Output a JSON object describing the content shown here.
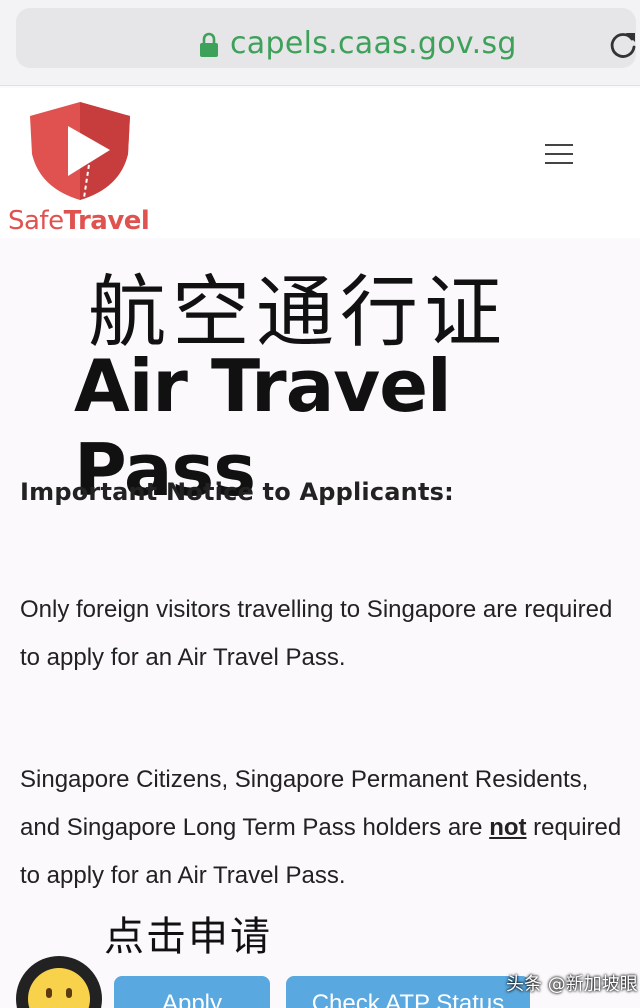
{
  "browser": {
    "url": "capels.caas.gov.sg",
    "lock_icon": "lock-icon",
    "reload_icon": "reload-icon",
    "url_color": "#3da15a"
  },
  "header": {
    "logo_safe": "Safe",
    "logo_travel": "Travel",
    "logo_color": "#e0524f",
    "menu_icon": "hamburger-menu-icon"
  },
  "hero": {
    "title_cn": "航空通行证",
    "title_en": "Air Travel Pass"
  },
  "notice": {
    "heading": "Important Notice to Applicants:",
    "para1": "Only foreign visitors travelling to Singapore are required to apply for an Air Travel Pass.",
    "para2_before": "Singapore Citizens, Singapore Permanent Residents, and Singapore Long Term Pass holders are ",
    "para2_emphasis": "not",
    "para2_after": " required to apply for an Air Travel Pass."
  },
  "cta": {
    "label_cn": "点击申请",
    "apply_label": "Apply",
    "check_label": "Check ATP Status",
    "button_color": "#59a8e0"
  },
  "overlay": {
    "emoji_icon": "smiley-face-icon",
    "watermark": "头条 @新加坡眼"
  }
}
